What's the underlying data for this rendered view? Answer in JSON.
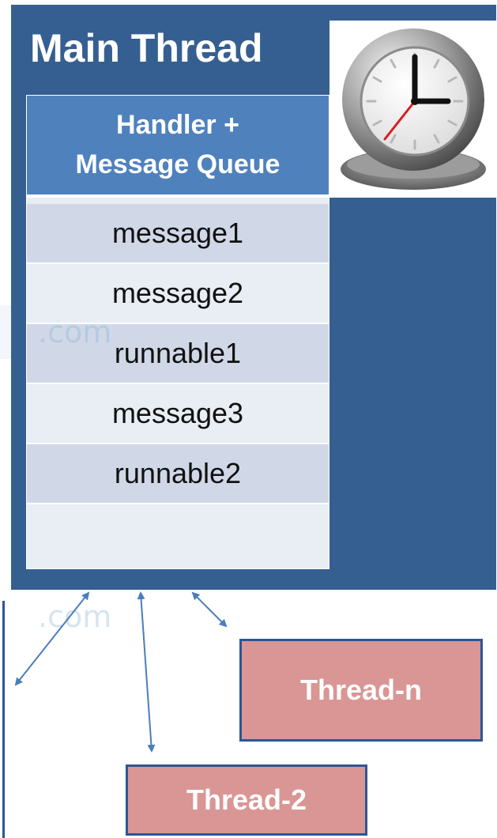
{
  "main_thread": {
    "title": "Main Thread",
    "queue": {
      "header_line1": "Handler +",
      "header_line2": "Message Queue",
      "items": [
        "message1",
        "message2",
        "runnable1",
        "message3",
        "runnable2",
        ""
      ]
    }
  },
  "threads": {
    "thread_n": "Thread-n",
    "thread_2": "Thread-2"
  },
  "watermark": ".com",
  "colors": {
    "main_bg": "#365f91",
    "queue_header": "#4f81bd",
    "thread_box": "#d99694",
    "arrow": "#4a7ebb"
  },
  "icon": "clock-icon"
}
